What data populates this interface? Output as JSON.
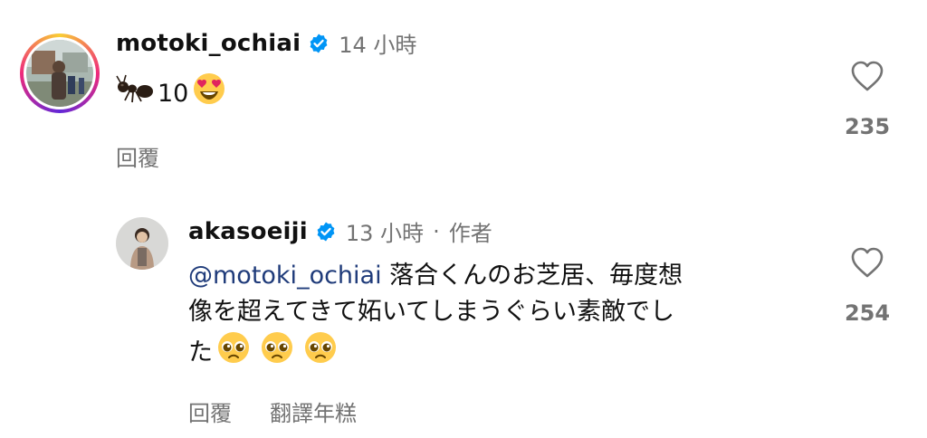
{
  "comments": [
    {
      "username": "motoki_ochiai",
      "time": "14 小時",
      "text_count": "10",
      "actions": {
        "reply": "回覆"
      },
      "likes": "235"
    },
    {
      "username": "akasoeiji",
      "time": "13 小時",
      "separator": "·",
      "author_badge": "作者",
      "mention": "@motoki_ochiai",
      "text_line1": " 落合くんのお芝居、毎度想",
      "text_line2": "像を超えてきて妬いてしまうぐらい素敵でし",
      "text_line3": "た",
      "actions": {
        "reply": "回覆",
        "translate": "翻譯年糕"
      },
      "likes": "254"
    }
  ],
  "icons": {
    "verified": "verified-badge-icon",
    "heart": "heart-outline-icon",
    "emoji_ant": "ant-emoji",
    "emoji_heart_eyes": "heart-eyes-emoji",
    "emoji_pleading": "pleading-face-emoji"
  },
  "colors": {
    "verified_blue": "#0095f6",
    "secondary_text": "#737373",
    "mention": "#1f3b7a"
  }
}
